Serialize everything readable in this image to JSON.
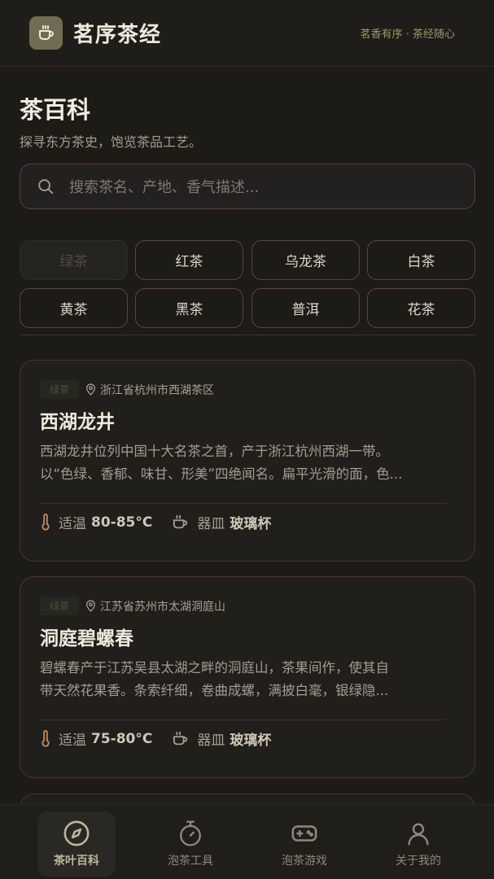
{
  "header": {
    "app_title": "茗序茶经",
    "slogan": "茗香有序 · 茶经随心",
    "logo_icon": "teacup-icon"
  },
  "page": {
    "title": "茶百科",
    "subtitle": "探寻东方茶史，饱览茶品工艺。"
  },
  "search": {
    "placeholder": "搜索茶名、产地、香气描述..."
  },
  "categories": [
    {
      "label": "绿茶",
      "active": true
    },
    {
      "label": "红茶",
      "active": false
    },
    {
      "label": "乌龙茶",
      "active": false
    },
    {
      "label": "白茶",
      "active": false
    },
    {
      "label": "黄茶",
      "active": false
    },
    {
      "label": "黑茶",
      "active": false
    },
    {
      "label": "普洱",
      "active": false
    },
    {
      "label": "花茶",
      "active": false
    }
  ],
  "teas": [
    {
      "tag": "绿茶",
      "origin": "浙江省杭州市西湖茶区",
      "name": "西湖龙井",
      "description": "西湖龙井位列中国十大名茶之首，产于浙江杭州西湖一带。\n以“色绿、香郁、味甘、形美”四绝闻名。扁平光滑的面，色...",
      "temp_label": "适温",
      "temp_value": "80-85°C",
      "vessel_label": "器皿",
      "vessel_value": "玻璃杯"
    },
    {
      "tag": "绿茶",
      "origin": "江苏省苏州市太湖洞庭山",
      "name": "洞庭碧螺春",
      "description": "碧螺春产于江苏吴县太湖之畔的洞庭山，茶果间作，使其自\n带天然花果香。条索纤细，卷曲成螺，满披白毫，银绿隐...",
      "temp_label": "适温",
      "temp_value": "75-80°C",
      "vessel_label": "器皿",
      "vessel_value": "玻璃杯"
    }
  ],
  "nav": [
    {
      "label": "茶叶百科",
      "icon": "compass-icon",
      "active": true
    },
    {
      "label": "泡茶工具",
      "icon": "timer-icon",
      "active": false
    },
    {
      "label": "泡茶游戏",
      "icon": "gamepad-icon",
      "active": false
    },
    {
      "label": "关于我的",
      "icon": "user-icon",
      "active": false
    }
  ],
  "colors": {
    "background": "#1d1b18",
    "accent": "#6f6c52",
    "active_nav": "#bdb89a"
  }
}
